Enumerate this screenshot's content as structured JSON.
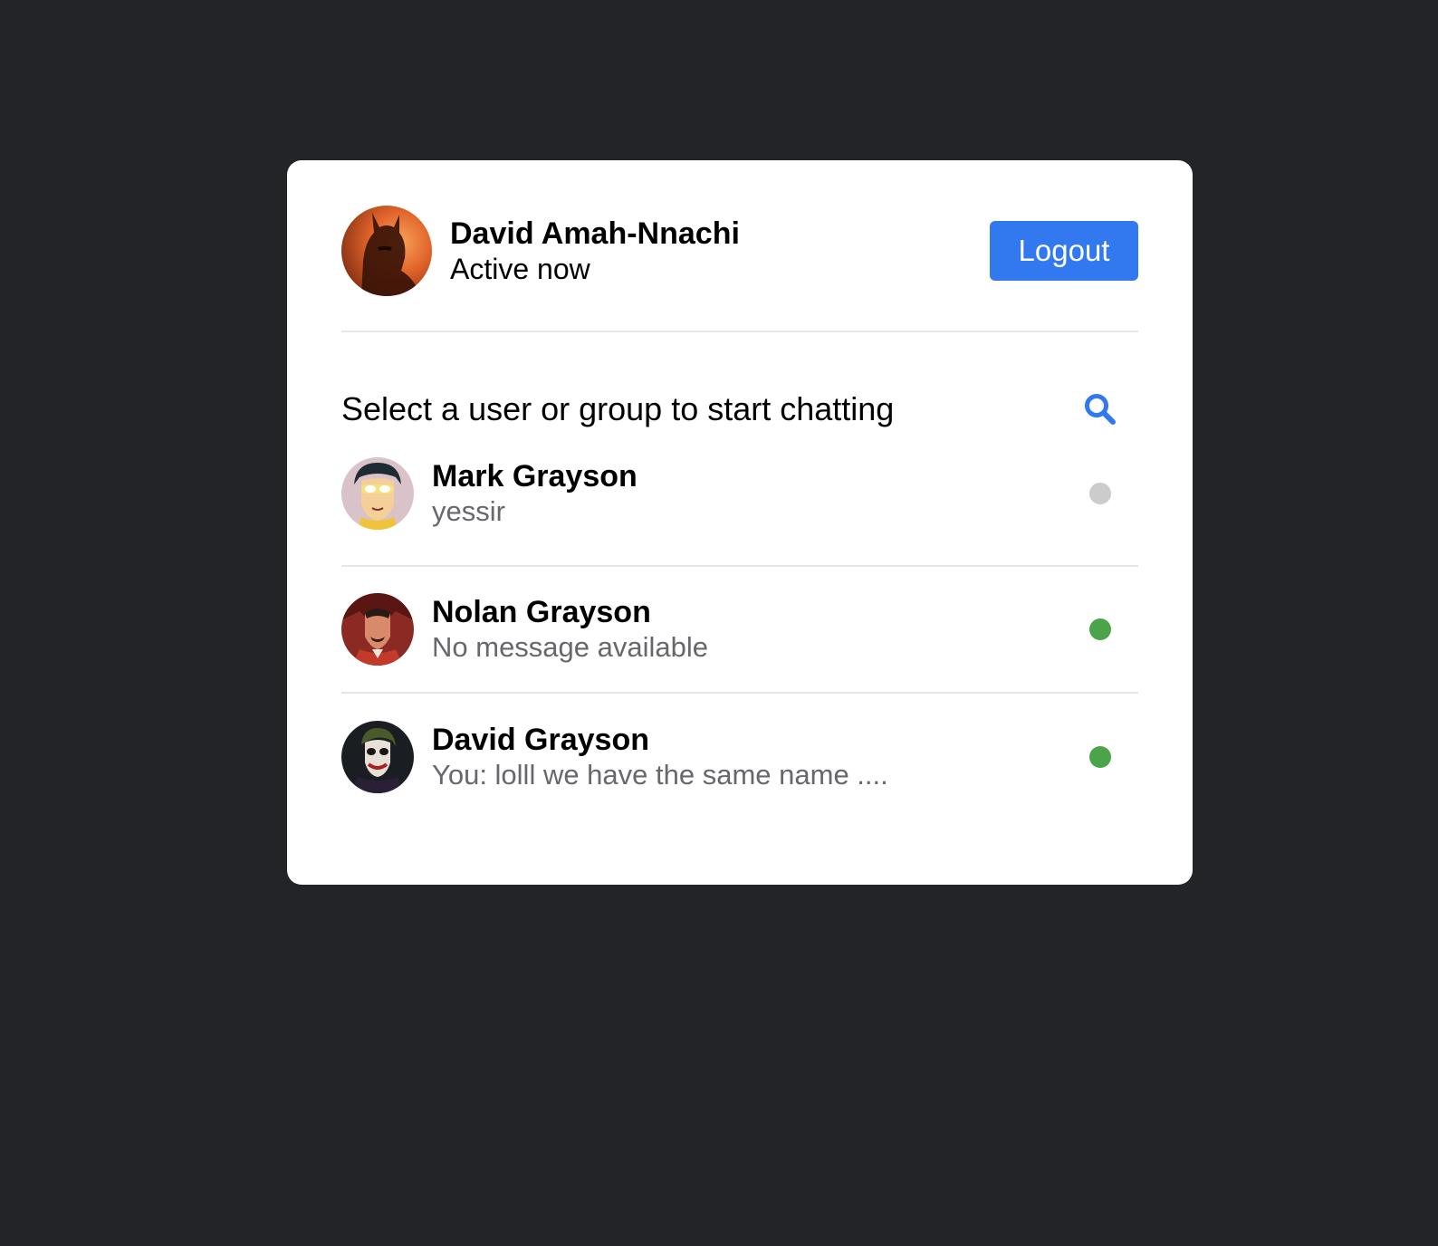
{
  "me": {
    "name": "David Amah-Nnachi",
    "status": "Active now",
    "avatar": "batman-avatar"
  },
  "header": {
    "logout_label": "Logout"
  },
  "search": {
    "prompt": "Select a user or group to start chatting",
    "icon": "search-icon"
  },
  "colors": {
    "accent": "#3279f0",
    "online": "#4ca44a",
    "offline": "#cccccc",
    "background": "#232427"
  },
  "users": [
    {
      "name": "Mark Grayson",
      "message": "yessir",
      "status": "offline",
      "avatar": "invincible-avatar"
    },
    {
      "name": "Nolan Grayson",
      "message": "No message available",
      "status": "online",
      "avatar": "omni-man-avatar"
    },
    {
      "name": "David Grayson",
      "message": "You: lolll we have the same name ....",
      "status": "online",
      "avatar": "joker-avatar"
    }
  ]
}
